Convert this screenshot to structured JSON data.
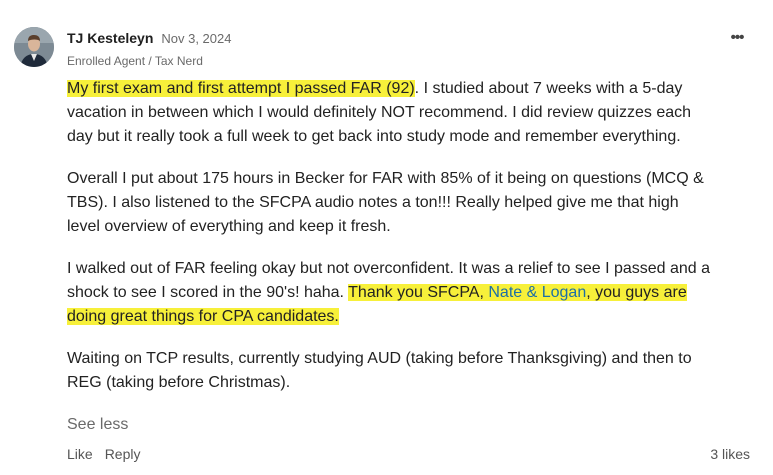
{
  "author": {
    "name": "TJ Kesteleyn",
    "date": "Nov 3, 2024",
    "title": "Enrolled Agent / Tax Nerd"
  },
  "menu": {
    "more_label": "•••"
  },
  "post": {
    "p1_highlight": "My first exam and first attempt I passed FAR (92)",
    "p1_rest": ". I studied about 7 weeks with a 5-day vacation in between which I would definitely NOT recommend. I did review quizzes each day but it really took a full week to get back into study mode and remember everything.",
    "p2": "Overall I put about 175 hours in Becker for FAR with 85% of it being on questions (MCQ & TBS). I also listened to the SFCPA audio notes a ton!!! Really helped give me that high level overview of everything and keep it fresh.",
    "p3_plain": "I walked out of FAR feeling okay but not overconfident. It was a relief to see I passed and a shock to see I scored in the 90's! haha. ",
    "p3_hl_before": "Thank you SFCPA, ",
    "p3_mention": "Nate & Logan",
    "p3_hl_after": ", you guys are doing great things for CPA candidates.",
    "p4": "Waiting on TCP results, currently studying AUD (taking before Thanksgiving) and then to REG (taking before Christmas)."
  },
  "actions": {
    "see_less": "See less",
    "like": "Like",
    "reply": "Reply",
    "likes": "3 likes"
  },
  "colors": {
    "highlight": "#f7f03a",
    "mention": "#1d6fa5",
    "muted": "#6a6a6a"
  }
}
